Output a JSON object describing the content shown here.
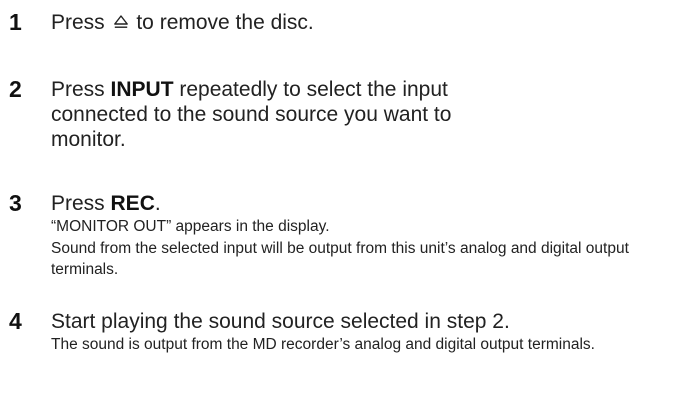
{
  "steps": [
    {
      "number": "1",
      "text_before": "Press ",
      "icon": "eject-icon",
      "text_after": " to remove the disc."
    },
    {
      "number": "2",
      "text_before": "Press ",
      "bold": "INPUT",
      "text_after": " repeatedly to select the input connected to the sound source you want to monitor."
    },
    {
      "number": "3",
      "text_before": "Press ",
      "bold": "REC",
      "text_after": ".",
      "details": [
        "“MONITOR OUT” appears in the display.",
        "Sound from the selected input will be output from this unit’s analog and digital output terminals."
      ]
    },
    {
      "number": "4",
      "text_before": "Start playing the sound source selected in step 2.",
      "details": [
        "The sound is output from the MD recorder’s analog and digital output terminals."
      ]
    }
  ]
}
